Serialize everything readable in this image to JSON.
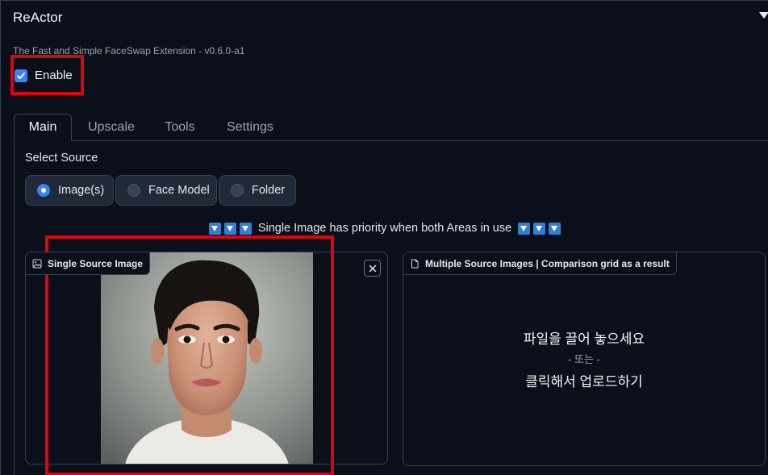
{
  "extension": {
    "title": "ReActor",
    "subtitle": "The Fast and Simple FaceSwap Extension - v0.6.0-a1",
    "enable_label": "Enable",
    "enable_checked": true
  },
  "tabs": [
    {
      "label": "Main",
      "active": true
    },
    {
      "label": "Upscale",
      "active": false
    },
    {
      "label": "Tools",
      "active": false
    },
    {
      "label": "Settings",
      "active": false
    }
  ],
  "source": {
    "label": "Select Source",
    "options": [
      {
        "label": "Image(s)",
        "selected": true
      },
      {
        "label": "Face Model",
        "selected": false
      },
      {
        "label": "Folder",
        "selected": false
      }
    ]
  },
  "priority_note": "Single Image has priority when both Areas in use",
  "single_source": {
    "label": "Single Source Image"
  },
  "multiple_source": {
    "label": "Multiple Source Images | Comparison grid as a result",
    "drop_line1": "파일을 끌어 놓으세요",
    "drop_line2": "- 또는 -",
    "drop_line3": "클릭해서 업로드하기"
  },
  "colors": {
    "background": "#0b0f19",
    "accent": "#3b82f6",
    "highlight": "#e3000f"
  }
}
